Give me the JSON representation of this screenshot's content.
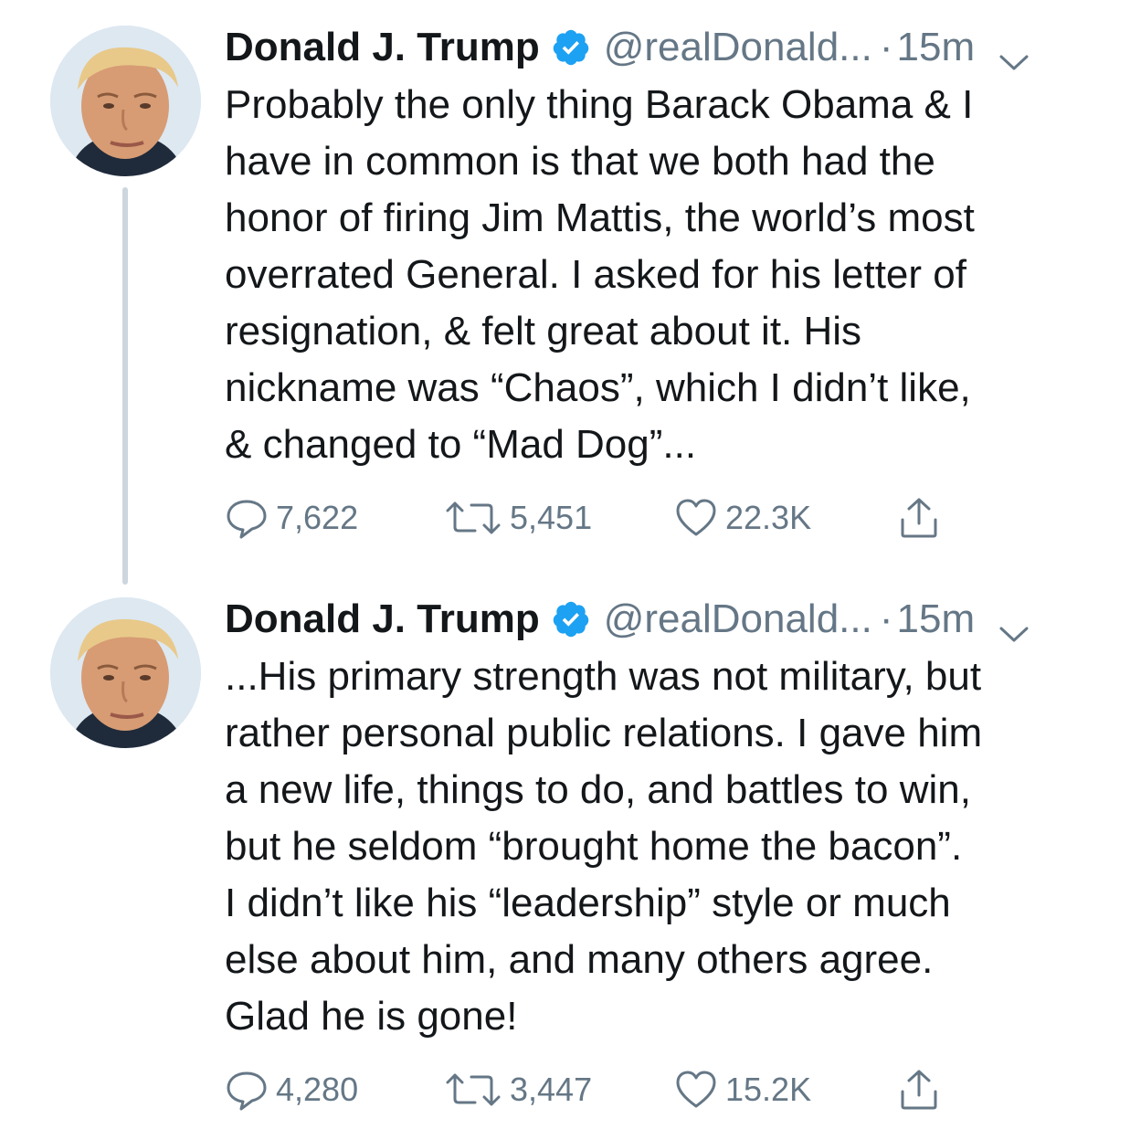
{
  "thread": {
    "tweets": [
      {
        "name": "Donald J. Trump",
        "handle": "@realDonald...",
        "separator": "·",
        "time": "15m",
        "text": "Probably the only thing Barack Obama & I\nhave in common is that we both had the\nhonor of firing Jim Mattis, the world’s most\noverrated General. I asked for his letter of\nresignation, & felt great about it. His\nnickname was “Chaos”, which I didn’t like,\n& changed to “Mad Dog”...",
        "replies": "7,622",
        "retweets": "5,451",
        "likes": "22.3K"
      },
      {
        "name": "Donald J. Trump",
        "handle": "@realDonald...",
        "separator": "·",
        "time": "15m",
        "text": "...His primary strength was not military, but\nrather personal public relations. I gave him\na new life, things to do, and battles to win,\nbut he seldom “brought home the bacon”.\nI didn’t like his “leadership” style or much\nelse about him, and many others agree.\nGlad he is gone!",
        "replies": "4,280",
        "retweets": "3,447",
        "likes": "15.2K"
      }
    ]
  },
  "icons": {
    "verified": "verified-badge-icon",
    "caret": "chevron-down-icon",
    "reply": "reply-icon",
    "retweet": "retweet-icon",
    "like": "heart-icon",
    "share": "share-icon"
  },
  "colors": {
    "text": "#14171a",
    "secondary": "#657786",
    "verified": "#1da1f2",
    "thread_line": "#ccd6dd"
  }
}
